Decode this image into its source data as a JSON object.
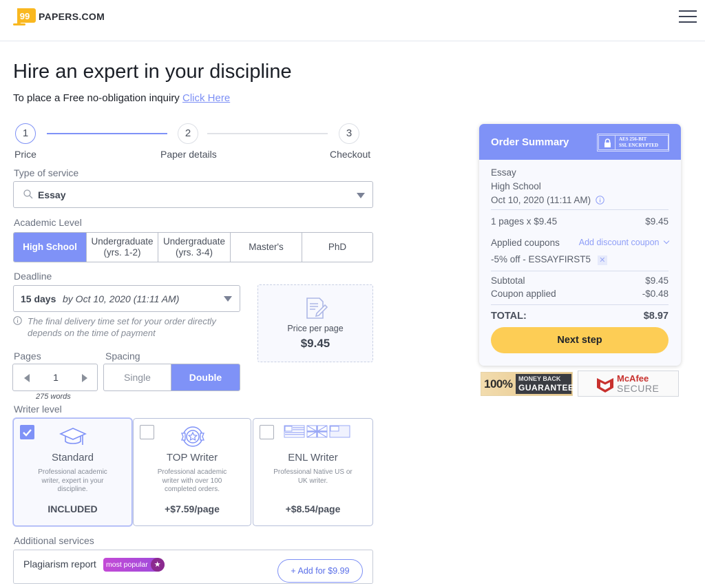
{
  "header": {
    "logo_text": "PAPERS.COM",
    "menu_icon": "hamburger-menu-icon"
  },
  "page": {
    "title": "Hire an expert in your discipline",
    "subtitle_text": "To place a Free no-obligation inquiry",
    "subtitle_link": "Click Here"
  },
  "steps": [
    {
      "number": "1",
      "label": "Price",
      "active": true
    },
    {
      "number": "2",
      "label": "Paper details",
      "active": false
    },
    {
      "number": "3",
      "label": "Checkout",
      "active": false
    }
  ],
  "service": {
    "label": "Type of service",
    "value": "Essay"
  },
  "academic_level": {
    "label": "Academic Level",
    "options": [
      "High School",
      "Undergraduate (yrs. 1-2)",
      "Undergraduate (yrs. 3-4)",
      "Master's",
      "PhD"
    ],
    "option_lines": [
      [
        "High School"
      ],
      [
        "Undergraduate",
        "(yrs. 1-2)"
      ],
      [
        "Undergraduate",
        "(yrs. 3-4)"
      ],
      [
        "Master's"
      ],
      [
        "PhD"
      ]
    ],
    "selected": "High School"
  },
  "deadline": {
    "label": "Deadline",
    "value": "15 days",
    "by_date": "by Oct 10, 2020 (11:11 AM)",
    "note": "The final delivery time set for your order directly depends on the time of payment"
  },
  "price_per_page": {
    "label": "Price per page",
    "value": "$9.45"
  },
  "pages": {
    "label": "Pages",
    "value": "1",
    "words": "275 words"
  },
  "spacing": {
    "label": "Spacing",
    "options": [
      "Single",
      "Double"
    ],
    "selected": "Double"
  },
  "writer_level": {
    "label": "Writer level",
    "options": [
      {
        "title": "Standard",
        "description": "Professional academic writer, expert in your discipline.",
        "price": "INCLUDED",
        "selected": true,
        "icon": "graduation-cap-icon"
      },
      {
        "title": "TOP Writer",
        "description": "Professional academic writer with over 100 completed orders.",
        "price": "+$7.59/page",
        "selected": false,
        "icon": "award-badge-icon"
      },
      {
        "title": "ENL Writer",
        "description": "Professional Native US or UK writer.",
        "price": "+$8.54/page",
        "selected": false,
        "icon": "flags-icon"
      }
    ]
  },
  "additional_services": {
    "label": "Additional services",
    "items": [
      {
        "name": "Plagiarism report",
        "badge": "most popular",
        "button": "+ Add for $9.99"
      }
    ]
  },
  "summary": {
    "title": "Order Summary",
    "ssl_line1": "AES 256-BIT",
    "ssl_line2": "SSL ENCRYPTED",
    "service": "Essay",
    "level": "High School",
    "deadline": "Oct 10, 2020 (11:11 AM)",
    "pages_line": "1 pages x $9.45",
    "pages_total": "$9.45",
    "coupons_label": "Applied coupons",
    "add_coupon": "Add discount coupon",
    "coupon": "-5% off - ESSAYFIRST5",
    "subtotal_label": "Subtotal",
    "subtotal": "$9.45",
    "coupon_applied_label": "Coupon applied",
    "coupon_applied": "-$0.48",
    "total_label": "TOTAL:",
    "total": "$8.97",
    "next_button": "Next step"
  },
  "badges": {
    "money_back_percent": "100%",
    "money_back_line1": "MONEY BACK",
    "money_back_line2": "GUARANTEE",
    "mcafee_line1": "McAfee",
    "mcafee_line2": "SECURE"
  },
  "colors": {
    "accent": "#7f92f7",
    "cta": "#fdcd55",
    "link": "#7c8ff5"
  }
}
